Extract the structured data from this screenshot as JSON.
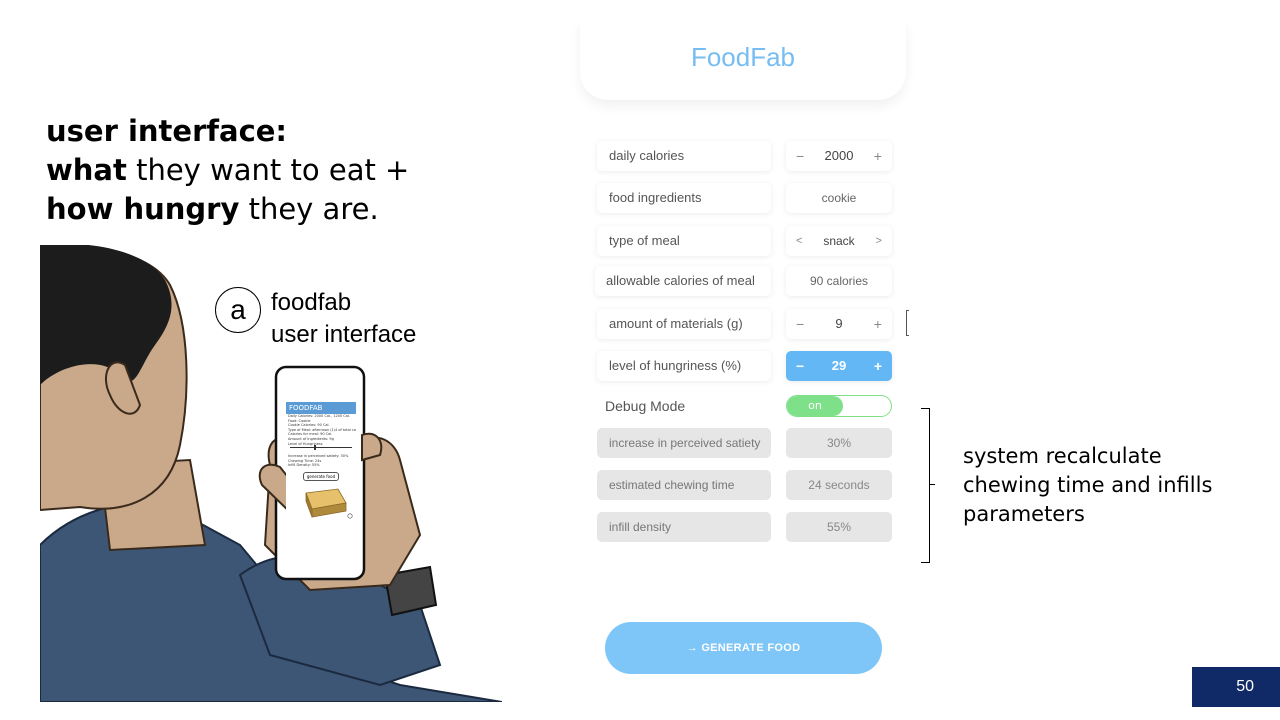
{
  "heading": {
    "line1_bold": "user interface:",
    "line2_bold": "what",
    "line2_rest": " they want to eat +",
    "line3_bold": "how hungry",
    "line3_rest": " they are."
  },
  "illustration": {
    "circle_letter": "a",
    "label_line1": "foodfab",
    "label_line2": "user interface",
    "phone": {
      "header": "FOODFAB",
      "lines": [
        "Daily Calories: 2000 Cal., 1200 Cal.",
        "Food: Cookie",
        "Cookie Calories: 90 Cal.",
        "Type of Meal: afternoon (1/4 of total cal.)",
        "Calories for meal: 90 Cal.",
        "Amount of Ingredients: 9g",
        "Level of Hungriness",
        "Increase in perceived satiety: 30%",
        "Chewing Time: 24s",
        "Infill Density: 55%"
      ],
      "button": "generate food"
    }
  },
  "app": {
    "title": "FoodFab",
    "rows": [
      {
        "label": "daily calories",
        "value": "2000",
        "minus": "−",
        "plus": "+"
      },
      {
        "label": "food ingredients",
        "value": "cookie"
      },
      {
        "label": "type of meal",
        "value": "snack",
        "prev": "<",
        "next": ">"
      },
      {
        "label": "allowable calories of meal",
        "value": "90 calories"
      },
      {
        "label": "amount of materials (g)",
        "value": "9",
        "minus": "−",
        "plus": "+"
      },
      {
        "label": "level of hungriness (%)",
        "value": "29",
        "minus": "−",
        "plus": "+"
      }
    ],
    "debug": {
      "label": "Debug Mode",
      "toggle": "on"
    },
    "debug_rows": [
      {
        "label": "increase in perceived satiety",
        "value": "30%"
      },
      {
        "label": "estimated chewing time",
        "value": "24 seconds"
      },
      {
        "label": "infill density",
        "value": "55%"
      }
    ],
    "generate": {
      "arrow": "→",
      "label": "GENERATE FOOD"
    }
  },
  "annotation": {
    "line1": "system recalculate",
    "line2": "chewing time and infills",
    "line3": "parameters"
  },
  "page_number": "50",
  "colors": {
    "accent": "#63b7f5",
    "title": "#76bdf3",
    "toggle": "#7fe08a",
    "page_badge": "#0f2a66",
    "jacket": "#3d5676",
    "skin": "#c9a98a"
  }
}
